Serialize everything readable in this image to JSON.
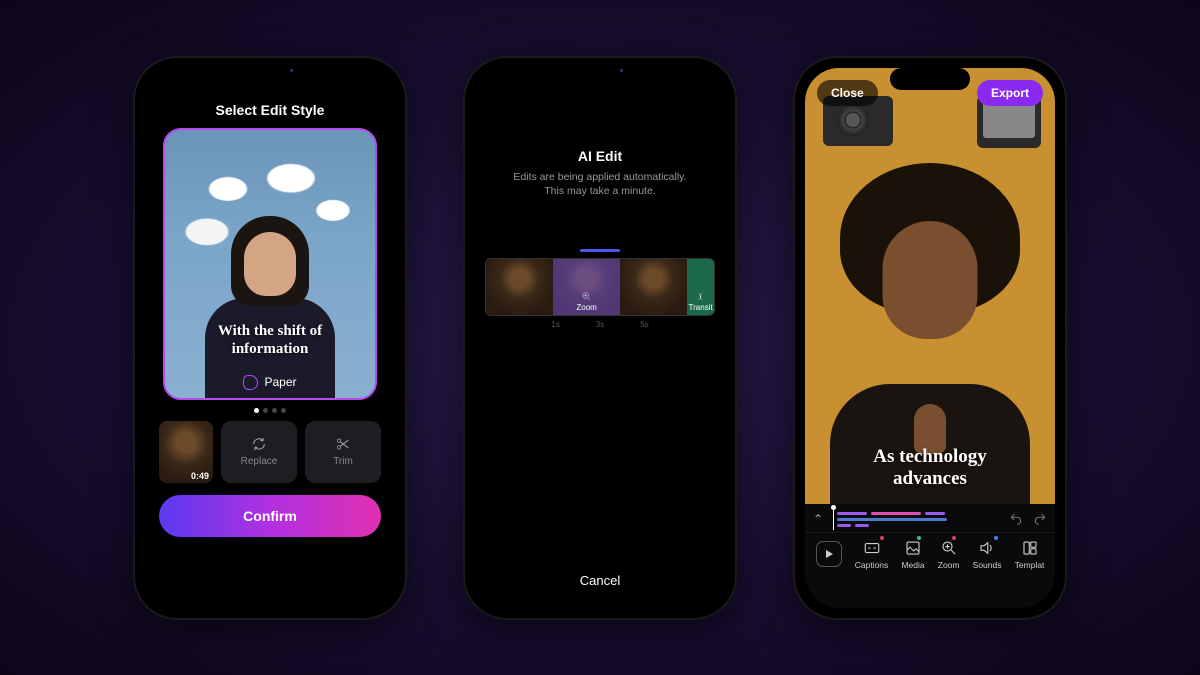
{
  "phone1": {
    "header": "Select Edit Style",
    "card": {
      "caption_l1": "With the shift of",
      "caption_l2": "information",
      "style_name": "Paper"
    },
    "clip_duration": "0:49",
    "actions": {
      "replace": "Replace",
      "trim": "Trim"
    },
    "confirm": "Confirm"
  },
  "phone2": {
    "title": "AI Edit",
    "subtitle_l1": "Edits are being applied automatically.",
    "subtitle_l2": "This may take a minute.",
    "segments": {
      "zoom": "Zoom",
      "transit": "Transit"
    },
    "ticks": [
      "",
      "1s",
      "3s",
      "5s",
      ""
    ],
    "cancel": "Cancel"
  },
  "phone3": {
    "close": "Close",
    "export": "Export",
    "caption_l1": "As technology",
    "caption_l2": "advances",
    "tools": {
      "captions": "Captions",
      "media": "Media",
      "zoom": "Zoom",
      "sounds": "Sounds",
      "templates": "Templat"
    }
  },
  "colors": {
    "accent": "#8a2af0",
    "track_purple": "#9a5af0",
    "track_pink": "#e050b0",
    "track_blue": "#4a7ad0"
  }
}
